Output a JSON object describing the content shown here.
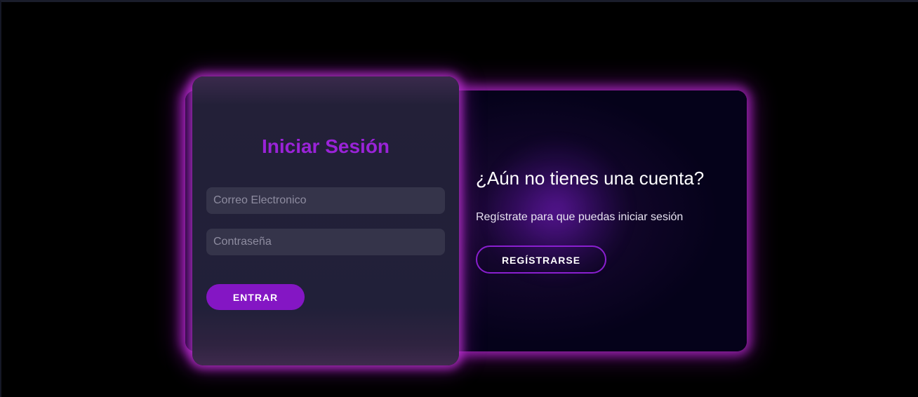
{
  "login": {
    "title": "Iniciar Sesión",
    "email_placeholder": "Correo Electronico",
    "email_value": "",
    "password_placeholder": "Contraseña",
    "password_value": "",
    "submit_label": "ENTRAR"
  },
  "signup_promo": {
    "title": "¿Aún no tienes una cuenta?",
    "text": "Regístrate para que puedas iniciar sesión",
    "button_label": "REGÍSTRARSE"
  },
  "colors": {
    "background": "#000000",
    "accent": "#8416c4",
    "title": "#9a23d8",
    "glow": "#b228c8",
    "card": "#212039",
    "input": "#35344a"
  }
}
